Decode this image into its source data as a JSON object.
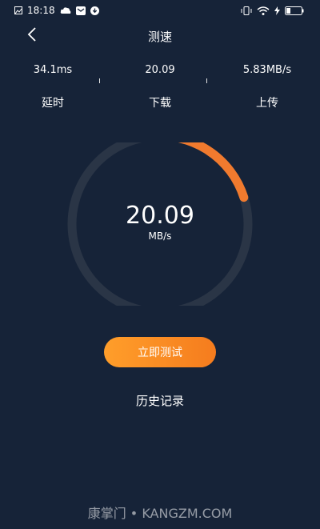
{
  "status_bar": {
    "time": "18:18",
    "icons_left": [
      "image-icon",
      "cloud-icon",
      "mail-icon",
      "download-icon"
    ],
    "icons_right": [
      "vibrate-icon",
      "wifi-icon",
      "charging-icon",
      "battery-icon"
    ]
  },
  "header": {
    "title": "测速",
    "back_icon": "chevron-left-icon"
  },
  "metrics": [
    {
      "value": "34.1ms",
      "label": "延时"
    },
    {
      "value": "20.09",
      "label": "下载"
    },
    {
      "value": "5.83MB/s",
      "label": "上传"
    }
  ],
  "gauge": {
    "speed": "20.09",
    "unit": "MB/s",
    "progress": 0.22
  },
  "actions": {
    "start_label": "立即测试",
    "history_label": "历史记录"
  },
  "watermark": "康掌门 • KANGZM.COM",
  "colors": {
    "background": "#162338",
    "track": "#2a3546",
    "accent": "#f07a2e",
    "button_start": "#ff9e2a",
    "button_end": "#f57c1e"
  }
}
